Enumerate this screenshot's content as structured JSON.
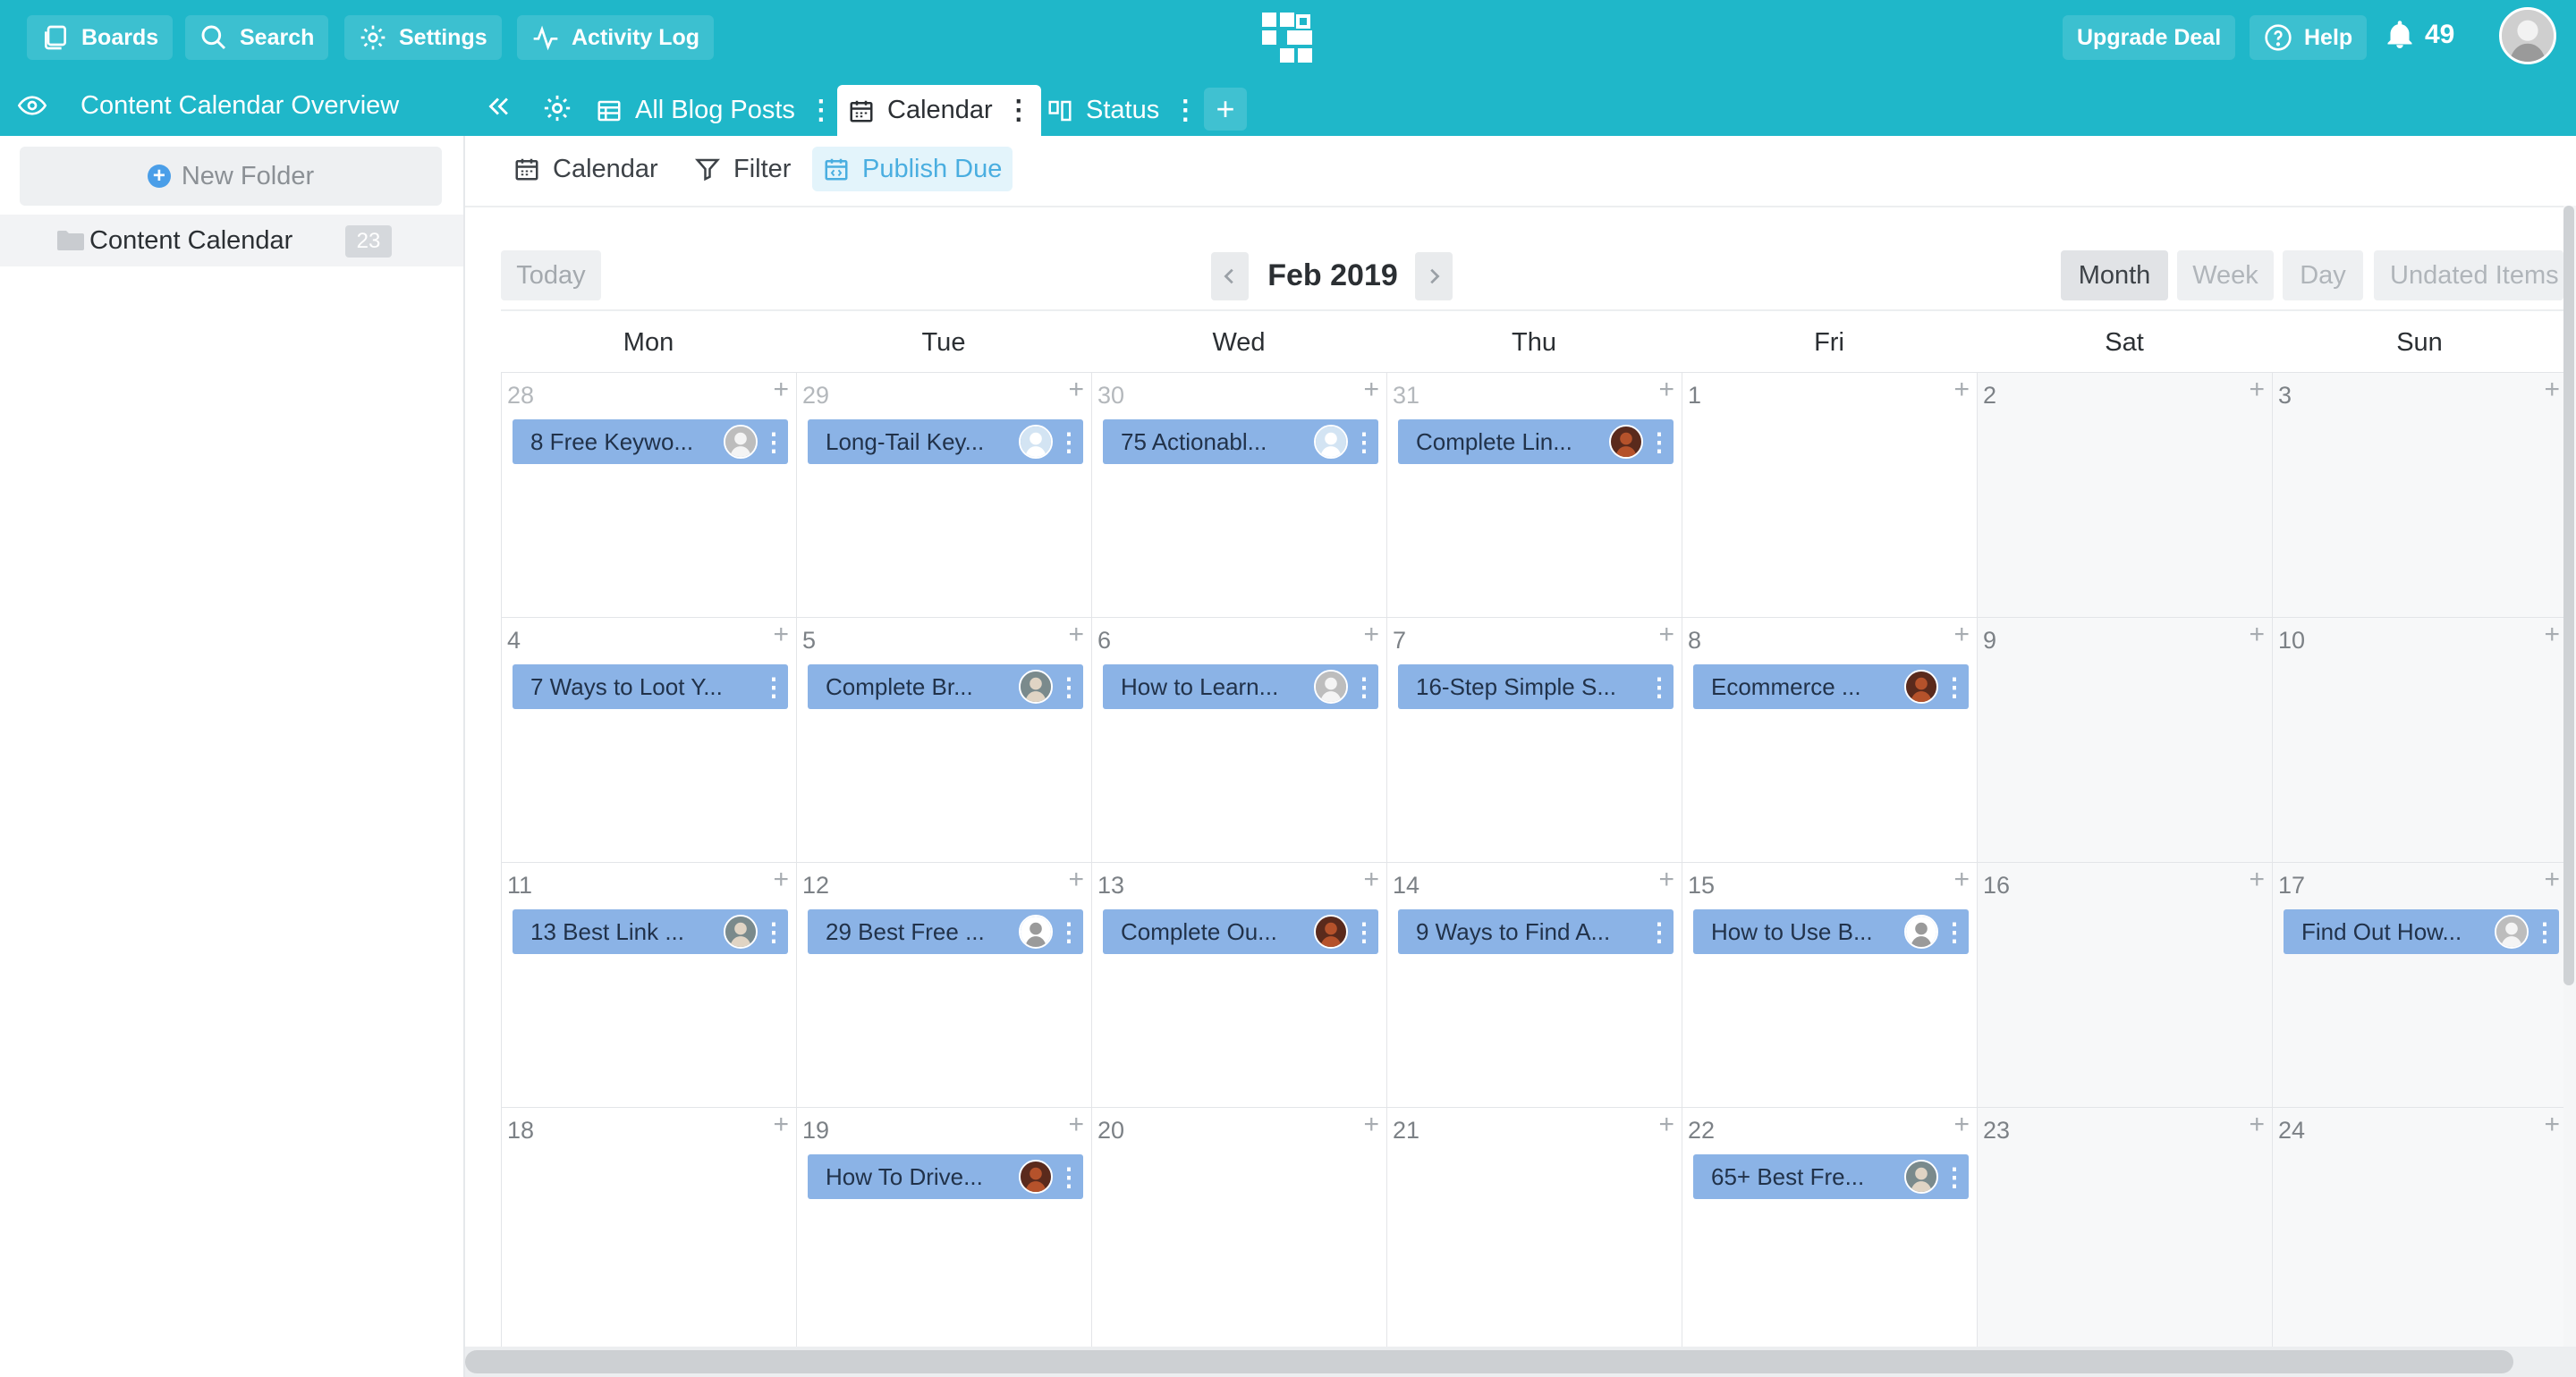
{
  "topbar": {
    "boards_label": "Boards",
    "search_label": "Search",
    "settings_label": "Settings",
    "activity_label": "Activity Log",
    "upgrade_label": "Upgrade Deal",
    "help_label": "Help",
    "notification_count": "49",
    "brand_color": "#1fb7c9"
  },
  "board": {
    "title": "Content Calendar Overview",
    "tabs": [
      {
        "label": "All Blog Posts",
        "icon": "table-icon"
      },
      {
        "label": "Calendar",
        "icon": "calendar-icon",
        "active": true
      },
      {
        "label": "Status",
        "icon": "kanban-icon"
      }
    ],
    "add_tab_symbol": "+"
  },
  "sidebar": {
    "new_folder_label": "New Folder",
    "folder": {
      "label": "Content Calendar",
      "count": "23"
    }
  },
  "toolbar": {
    "calendar_label": "Calendar",
    "filter_label": "Filter",
    "publish_due_label": "Publish Due"
  },
  "calendar": {
    "today_label": "Today",
    "month_label": "Feb 2019",
    "ranges": [
      {
        "label": "Month",
        "active": true
      },
      {
        "label": "Week",
        "active": false
      },
      {
        "label": "Day",
        "active": false
      },
      {
        "label": "Undated Items",
        "active": false
      }
    ],
    "days_of_week": [
      "Mon",
      "Tue",
      "Wed",
      "Thu",
      "Fri",
      "Sat",
      "Sun"
    ],
    "weeks": [
      [
        {
          "day": "28",
          "muted": true,
          "event": "8 Free Keywo...",
          "avatar": "grey-white"
        },
        {
          "day": "29",
          "muted": true,
          "event": "Long-Tail Key...",
          "avatar": "blue-light"
        },
        {
          "day": "30",
          "muted": true,
          "event": "75 Actionabl...",
          "avatar": "blue-light"
        },
        {
          "day": "31",
          "muted": true,
          "event": "Complete Lin...",
          "avatar": "dark-red"
        },
        {
          "day": "1"
        },
        {
          "day": "2",
          "weekend": true
        },
        {
          "day": "3",
          "weekend": true
        }
      ],
      [
        {
          "day": "4",
          "event": "7 Ways to Loot Y..."
        },
        {
          "day": "5",
          "event": "Complete Br...",
          "avatar": "grey-beard"
        },
        {
          "day": "6",
          "event": "How to Learn...",
          "avatar": "grey-white"
        },
        {
          "day": "7",
          "event": "16-Step Simple S..."
        },
        {
          "day": "8",
          "event": "Ecommerce ...",
          "avatar": "dark-red"
        },
        {
          "day": "9",
          "weekend": true
        },
        {
          "day": "10",
          "weekend": true
        }
      ],
      [
        {
          "day": "11",
          "event": "13 Best Link ...",
          "avatar": "grey-beard"
        },
        {
          "day": "12",
          "event": "29 Best Free ...",
          "avatar": "white-sketch"
        },
        {
          "day": "13",
          "event": "Complete Ou...",
          "avatar": "dark-red"
        },
        {
          "day": "14",
          "event": "9 Ways to Find A..."
        },
        {
          "day": "15",
          "event": "How to Use B...",
          "avatar": "white-sketch"
        },
        {
          "day": "16",
          "weekend": true
        },
        {
          "day": "17",
          "weekend": true,
          "event": "Find Out How...",
          "avatar": "grey-white"
        }
      ],
      [
        {
          "day": "18"
        },
        {
          "day": "19",
          "event": "How To Drive...",
          "avatar": "dark-red"
        },
        {
          "day": "20"
        },
        {
          "day": "21"
        },
        {
          "day": "22",
          "event": "65+ Best Fre...",
          "avatar": "grey-beard"
        },
        {
          "day": "23",
          "weekend": true
        },
        {
          "day": "24",
          "weekend": true
        }
      ]
    ],
    "event_color": "#8bb3e6"
  }
}
